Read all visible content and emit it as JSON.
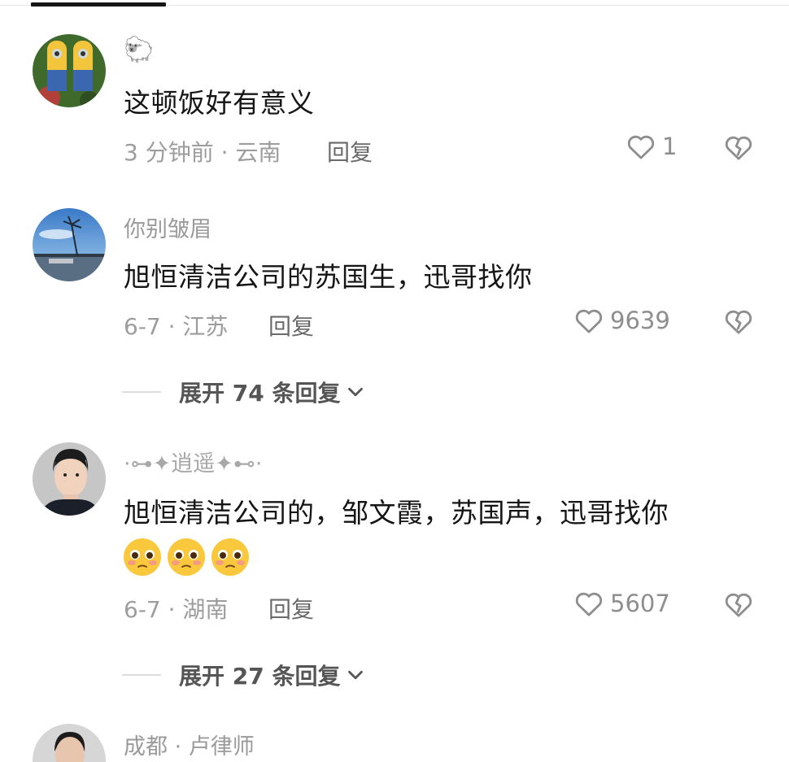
{
  "comments": [
    {
      "username": "🐑",
      "text": "这顿饭好有意义",
      "meta": "3 分钟前 · 云南",
      "reply_label": "回复",
      "likes": "1"
    },
    {
      "username": "你别皱眉",
      "text": "旭恒清洁公司的苏国生，迅哥找你",
      "meta": "6-7 · 江苏",
      "reply_label": "回复",
      "likes": "9639",
      "expand_label": "展开 74 条回复"
    },
    {
      "username": "·⊶✦逍遥✦⊷·",
      "text": "旭恒清洁公司的，邹文霞，苏国声，迅哥找你",
      "emoji_count": 3,
      "meta": "6-7 · 湖南",
      "reply_label": "回复",
      "likes": "5607",
      "expand_label": "展开 27 条回复"
    },
    {
      "username": "成都 · 卢律师"
    }
  ],
  "icons": {
    "like": "heart-outline-icon",
    "dislike": "broken-heart-icon",
    "expand": "chevron-down-icon"
  },
  "colors": {
    "text_primary": "#151515",
    "text_secondary": "#9d9d9d",
    "reply": "#6a6a6a"
  }
}
